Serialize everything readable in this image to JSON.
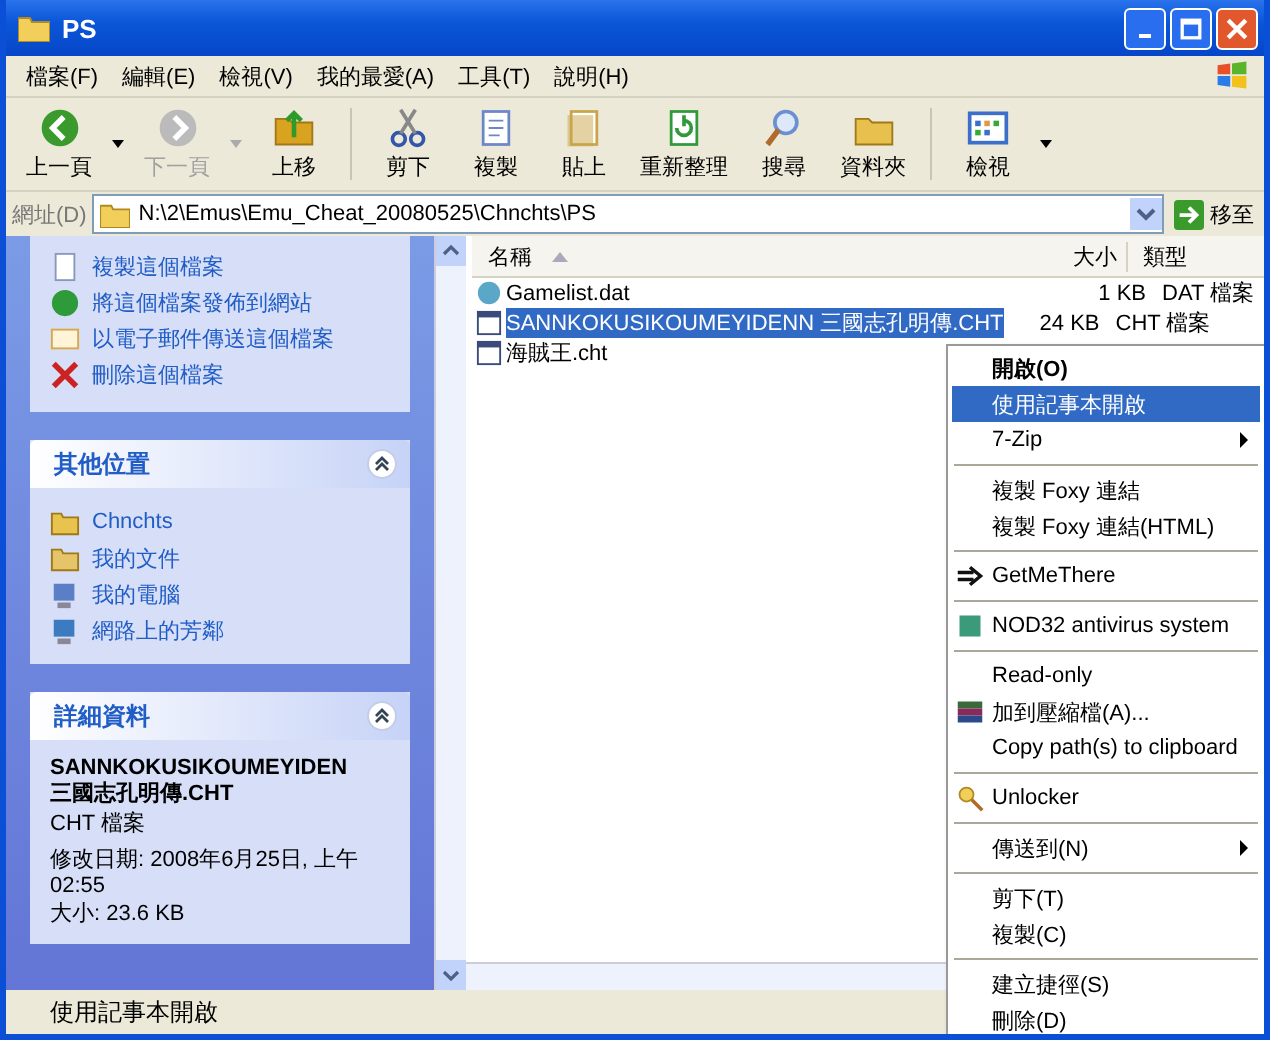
{
  "window": {
    "title": "PS"
  },
  "menu_bar": [
    "檔案(F)",
    "編輯(E)",
    "檢視(V)",
    "我的最愛(A)",
    "工具(T)",
    "說明(H)"
  ],
  "toolbar": [
    {
      "kind": "back",
      "label": "上一頁",
      "disabled": false,
      "dropdown": true
    },
    {
      "kind": "forward",
      "label": "下一頁",
      "disabled": true,
      "dropdown": true
    },
    {
      "kind": "up",
      "label": "上移",
      "disabled": false,
      "dropdown": false
    },
    {
      "kind": "cut",
      "label": "剪下",
      "disabled": false,
      "dropdown": false
    },
    {
      "kind": "copy",
      "label": "複製",
      "disabled": false,
      "dropdown": false
    },
    {
      "kind": "paste",
      "label": "貼上",
      "disabled": false,
      "dropdown": false
    },
    {
      "kind": "refresh",
      "label": "重新整理",
      "disabled": false,
      "dropdown": false
    },
    {
      "kind": "search",
      "label": "搜尋",
      "disabled": false,
      "dropdown": false
    },
    {
      "kind": "folders",
      "label": "資料夾",
      "disabled": false,
      "dropdown": false
    },
    {
      "kind": "views",
      "label": "檢視",
      "disabled": false,
      "dropdown": true
    }
  ],
  "address_bar": {
    "label": "網址(D)",
    "value": "N:\\2\\Emus\\Emu_Cheat_20080525\\Chnchts\\PS",
    "go_label": "移至"
  },
  "file_tasks": [
    {
      "kind": "copy",
      "label": "複製這個檔案"
    },
    {
      "kind": "publish",
      "label": "將這個檔案發佈到網站"
    },
    {
      "kind": "email",
      "label": "以電子郵件傳送這個檔案"
    },
    {
      "kind": "delete",
      "label": "刪除這個檔案"
    }
  ],
  "other_places": {
    "title": "其他位置",
    "items": [
      {
        "kind": "folder",
        "label": "Chnchts"
      },
      {
        "kind": "documents",
        "label": "我的文件"
      },
      {
        "kind": "computer",
        "label": "我的電腦"
      },
      {
        "kind": "network",
        "label": "網路上的芳鄰"
      }
    ]
  },
  "details": {
    "title": "詳細資料",
    "name_lines": [
      "SANNKOKUSIKOUMEYIDEN",
      "三國志孔明傳.CHT"
    ],
    "type": "CHT 檔案",
    "modified": "修改日期: 2008年6月25日, 上午 02:55",
    "size": "大小: 23.6 KB"
  },
  "file_list": {
    "columns": [
      {
        "label": "名稱",
        "sorted": true
      },
      {
        "label": "大小",
        "sorted": false
      },
      {
        "label": "類型",
        "sorted": false
      }
    ],
    "rows": [
      {
        "kind": "dat",
        "name": "Gamelist.dat",
        "size": "1 KB",
        "type": "DAT 檔案",
        "selected": false
      },
      {
        "kind": "cht",
        "name": "SANNKOKUSIKOUMEYIDENN 三國志孔明傳.CHT",
        "size": "24 KB",
        "type": "CHT 檔案",
        "selected": true
      },
      {
        "kind": "cht",
        "name": "海賊王.cht",
        "selected": false
      }
    ]
  },
  "context_menu": [
    {
      "kind": "item",
      "label": "開啟(O)",
      "default": true,
      "selected": false,
      "submenu": false
    },
    {
      "kind": "item",
      "label": "使用記事本開啟",
      "default": false,
      "selected": true,
      "submenu": false
    },
    {
      "kind": "item",
      "label": "7-Zip",
      "default": false,
      "selected": false,
      "submenu": true
    },
    {
      "kind": "separator"
    },
    {
      "kind": "item",
      "label": "複製 Foxy 連結",
      "default": false,
      "selected": false,
      "submenu": false
    },
    {
      "kind": "item",
      "label": "複製 Foxy 連結(HTML)",
      "default": false,
      "selected": false,
      "submenu": false
    },
    {
      "kind": "separator"
    },
    {
      "kind": "item",
      "label": "GetMeThere",
      "default": false,
      "selected": false,
      "submenu": false
    },
    {
      "kind": "separator"
    },
    {
      "kind": "item",
      "label": "NOD32 antivirus system",
      "default": false,
      "selected": false,
      "submenu": false
    },
    {
      "kind": "separator"
    },
    {
      "kind": "item",
      "label": "Read-only",
      "default": false,
      "selected": false,
      "submenu": false
    },
    {
      "kind": "item",
      "label": "加到壓縮檔(A)...",
      "default": false,
      "selected": false,
      "submenu": false
    },
    {
      "kind": "item",
      "label": "Copy path(s) to clipboard",
      "default": false,
      "selected": false,
      "submenu": false
    },
    {
      "kind": "separator"
    },
    {
      "kind": "item",
      "label": "Unlocker",
      "default": false,
      "selected": false,
      "submenu": false
    },
    {
      "kind": "separator"
    },
    {
      "kind": "item",
      "label": "傳送到(N)",
      "default": false,
      "selected": false,
      "submenu": true
    },
    {
      "kind": "separator"
    },
    {
      "kind": "item",
      "label": "剪下(T)",
      "default": false,
      "selected": false,
      "submenu": false
    },
    {
      "kind": "item",
      "label": "複製(C)",
      "default": false,
      "selected": false,
      "submenu": false
    },
    {
      "kind": "separator"
    },
    {
      "kind": "item",
      "label": "建立捷徑(S)",
      "default": false,
      "selected": false,
      "submenu": false
    },
    {
      "kind": "item",
      "label": "刪除(D)",
      "default": false,
      "selected": false,
      "submenu": false
    }
  ],
  "status_bar": "使用記事本開啟"
}
